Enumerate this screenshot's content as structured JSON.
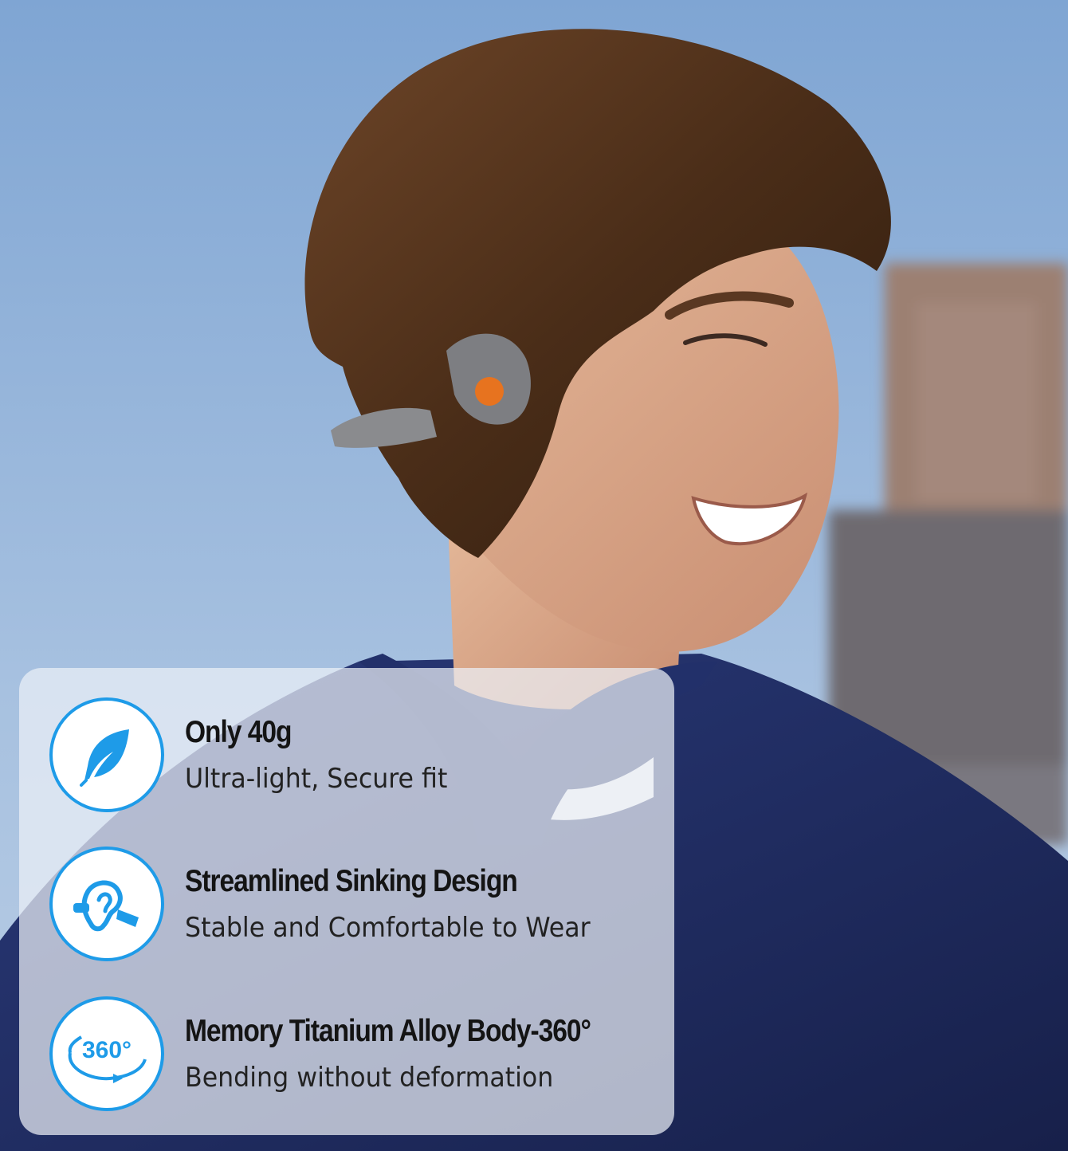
{
  "colors": {
    "accent": "#1e9be8",
    "sky": "#8fb1d8",
    "hoodie": "#1f2a5c",
    "earpiece_accent": "#e7731f"
  },
  "features": [
    {
      "icon": "feather-icon",
      "title": "Only 40g",
      "subtitle": "Ultra-light, Secure fit"
    },
    {
      "icon": "ear-icon",
      "title": "Streamlined Sinking Design",
      "subtitle": "Stable and Comfortable to Wear"
    },
    {
      "icon": "rotate-360-icon",
      "icon_text": "360°",
      "title": "Memory Titanium Alloy Body-360°",
      "subtitle": "Bending without deformation"
    }
  ]
}
